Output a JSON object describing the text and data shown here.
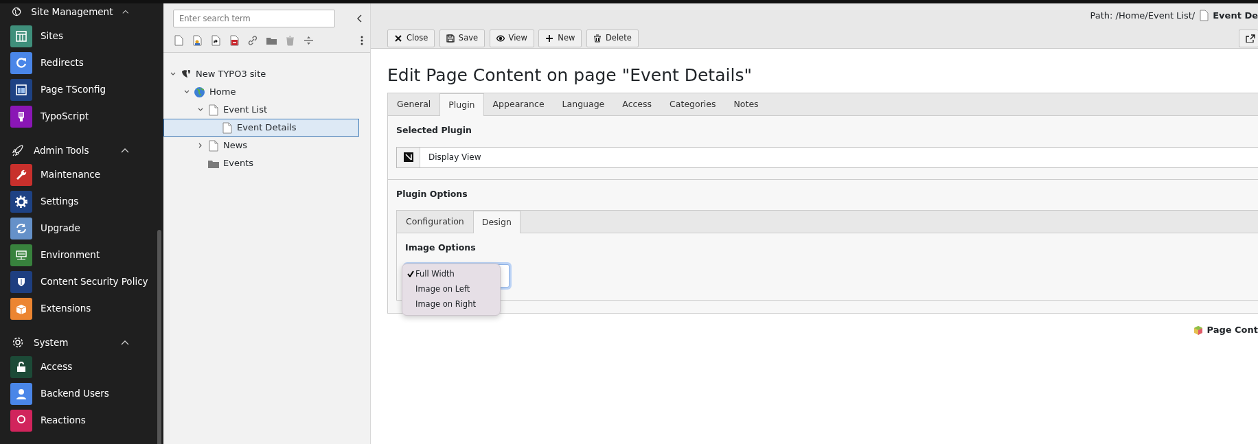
{
  "sidebar": {
    "groups": [
      {
        "label": "Site Management",
        "expanded": true,
        "items": [
          {
            "label": "Sites",
            "color": "#3f8f7b"
          },
          {
            "label": "Redirects",
            "color": "#4a86e8"
          },
          {
            "label": "Page TSconfig",
            "color": "#1e4284"
          },
          {
            "label": "TypoScript",
            "color": "#8a16b5"
          }
        ]
      },
      {
        "label": "Admin Tools",
        "expanded": true,
        "items": [
          {
            "label": "Maintenance",
            "color": "#c8302c"
          },
          {
            "label": "Settings",
            "color": "#1e4284"
          },
          {
            "label": "Upgrade",
            "color": "#6591c9"
          },
          {
            "label": "Environment",
            "color": "#38823d"
          },
          {
            "label": "Content Security Policy",
            "color": "#1e3f80"
          },
          {
            "label": "Extensions",
            "color": "#ec8531"
          }
        ]
      },
      {
        "label": "System",
        "expanded": true,
        "items": [
          {
            "label": "Access",
            "color": "#1c4a37"
          },
          {
            "label": "Backend Users",
            "color": "#4a86e8"
          },
          {
            "label": "Reactions",
            "color": "#d1245c"
          }
        ]
      }
    ]
  },
  "page_tree": {
    "search": {
      "placeholder": "Enter search term"
    },
    "nodes": [
      {
        "label": "New TYPO3 site",
        "kind": "site",
        "expanded": true,
        "selected": false,
        "children": [
          {
            "label": "Home",
            "kind": "home",
            "expanded": true,
            "selected": false,
            "children": [
              {
                "label": "Event List",
                "kind": "page",
                "expanded": true,
                "selected": false,
                "children": [
                  {
                    "label": "Event Details",
                    "kind": "page",
                    "selected": true
                  }
                ]
              },
              {
                "label": "News",
                "kind": "page",
                "expanded": false,
                "selected": false
              },
              {
                "label": "Events",
                "kind": "folder",
                "selected": false
              }
            ]
          }
        ]
      }
    ]
  },
  "header": {
    "path": "Path: /Home/Event List/",
    "path_page": "Event De"
  },
  "buttons": [
    "Close",
    "Save",
    "View",
    "New",
    "Delete"
  ],
  "title": "Edit Page Content on page \"Event Details\"",
  "tabs": [
    {
      "label": "General",
      "selected": false
    },
    {
      "label": "Plugin",
      "selected": true
    },
    {
      "label": "Appearance",
      "selected": false
    },
    {
      "label": "Language",
      "selected": false
    },
    {
      "label": "Access",
      "selected": false
    },
    {
      "label": "Categories",
      "selected": false
    },
    {
      "label": "Notes",
      "selected": false
    }
  ],
  "selected_plugin": {
    "label": "Selected Plugin",
    "value": "Display View"
  },
  "plugin_options": {
    "label": "Plugin Options",
    "tabs": [
      {
        "label": "Configuration",
        "selected": false
      },
      {
        "label": "Design",
        "selected": true
      }
    ],
    "image_options": {
      "label": "Image Options",
      "open": true,
      "options": [
        {
          "label": "Full Width",
          "selected": true
        },
        {
          "label": "Image on Left",
          "selected": false
        },
        {
          "label": "Image on Right",
          "selected": false
        }
      ]
    }
  },
  "footer": {
    "label": "Page Cont"
  }
}
